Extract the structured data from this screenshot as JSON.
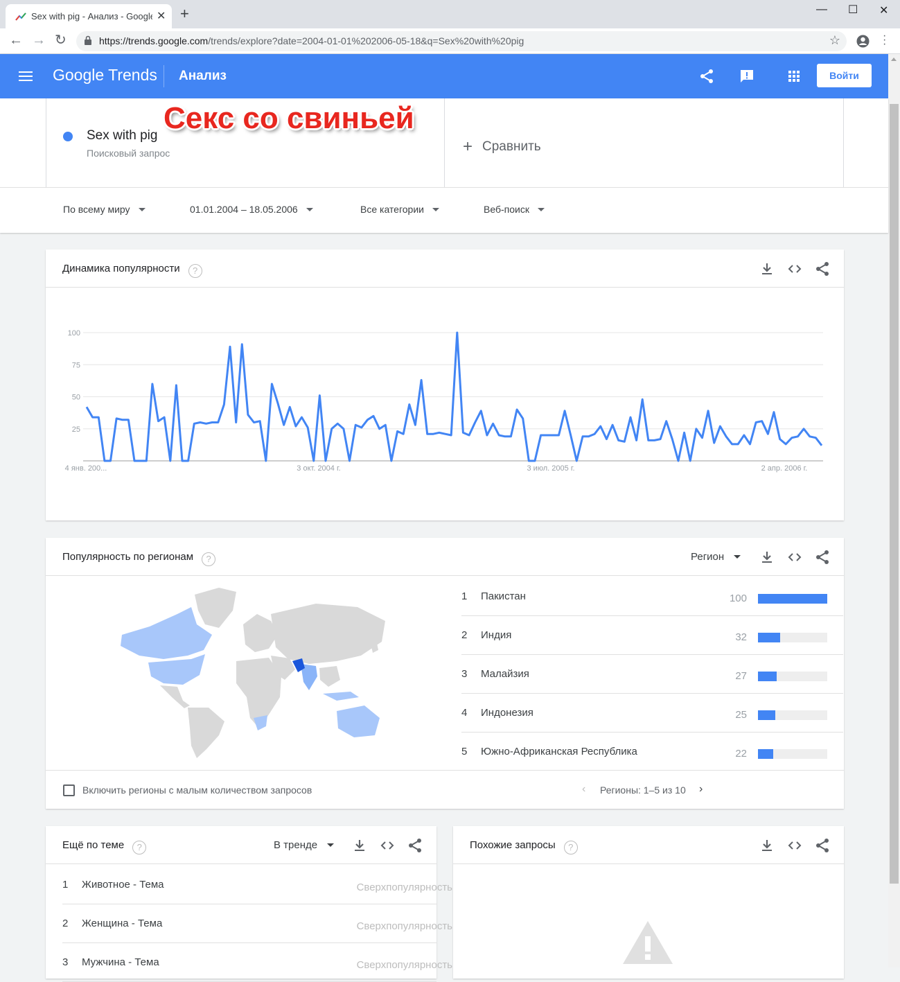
{
  "browser": {
    "tab_title": "Sex with pig - Анализ - Google T",
    "url_host": "https://trends.google.com",
    "url_rest": "/trends/explore?date=2004-01-01%202006-05-18&q=Sex%20with%20pig",
    "icons": [
      "back-arrow-icon",
      "forward-arrow-icon",
      "reload-icon",
      "lock-icon",
      "star-icon",
      "account-icon",
      "menu-dots-icon"
    ]
  },
  "header": {
    "logo": "Google Trends",
    "section": "Анализ",
    "signin_label": "Войти",
    "brand_color": "#4285f4"
  },
  "overlay": {
    "title": "Секс со свиньей",
    "color": "#e8271f"
  },
  "explore": {
    "term_name": "Sex with pig",
    "term_type": "Поисковый запрос",
    "term_color": "#4285f4",
    "compare_label": "Сравнить",
    "filters": {
      "geo": "По всему миру",
      "date": "01.01.2004 – 18.05.2006",
      "category": "Все категории",
      "search_type": "Веб-поиск"
    }
  },
  "interest_over_time": {
    "title": "Динамика популярности",
    "help": "?"
  },
  "chart_data": {
    "type": "line",
    "ylim": [
      0,
      100
    ],
    "yticks": [
      "100",
      "75",
      "50",
      "25"
    ],
    "xtick_labels": [
      "4 янв. 200...",
      "3 окт. 2004 г.",
      "3 июл. 2005 г.",
      "2 апр. 2006 г."
    ],
    "series": [
      {
        "color": "#4285f4",
        "values": [
          42,
          34,
          34,
          0,
          0,
          33,
          32,
          32,
          0,
          0,
          0,
          60,
          31,
          34,
          0,
          59,
          0,
          0,
          29,
          30,
          29,
          30,
          30,
          44,
          89,
          30,
          91,
          36,
          30,
          31,
          0,
          60,
          45,
          28,
          42,
          27,
          34,
          26,
          0,
          51,
          0,
          25,
          29,
          25,
          0,
          28,
          26,
          32,
          35,
          25,
          28,
          0,
          23,
          21,
          44,
          28,
          63,
          21,
          21,
          22,
          21,
          20,
          100,
          22,
          20,
          30,
          39,
          20,
          29,
          20,
          19,
          19,
          40,
          33,
          0,
          0,
          20,
          20,
          20,
          20,
          39,
          20,
          0,
          19,
          19,
          21,
          27,
          17,
          28,
          16,
          15,
          34,
          16,
          48,
          16,
          16,
          17,
          31,
          17,
          0,
          22,
          0,
          25,
          18,
          39,
          14,
          27,
          19,
          13,
          13,
          20,
          13,
          30,
          31,
          21,
          38,
          17,
          13,
          18,
          19,
          25,
          19,
          18,
          12
        ]
      }
    ]
  },
  "regions": {
    "title": "Популярность по регионам",
    "help": "?",
    "resolution": "Регион",
    "rows": [
      {
        "rank": "1",
        "name": "Пакистан",
        "value": 100
      },
      {
        "rank": "2",
        "name": "Индия",
        "value": 32
      },
      {
        "rank": "3",
        "name": "Малайзия",
        "value": 27
      },
      {
        "rank": "4",
        "name": "Индонезия",
        "value": 25
      },
      {
        "rank": "5",
        "name": "Южно-Африканская Республика",
        "value": 22
      }
    ],
    "include_low_volume": "Включить регионы с малым количеством запросов",
    "pagination": "Регионы: 1–5 из 10"
  },
  "related_topics": {
    "title": "Ещё по теме",
    "help": "?",
    "mode": "В тренде",
    "rows": [
      {
        "rank": "1",
        "name": "Животное - Тема",
        "tag": "Сверхпопулярность"
      },
      {
        "rank": "2",
        "name": "Женщина - Тема",
        "tag": "Сверхпопулярность"
      },
      {
        "rank": "3",
        "name": "Мужчина - Тема",
        "tag": "Сверхпопулярность"
      }
    ]
  },
  "related_queries": {
    "title": "Похожие запросы",
    "help": "?"
  }
}
